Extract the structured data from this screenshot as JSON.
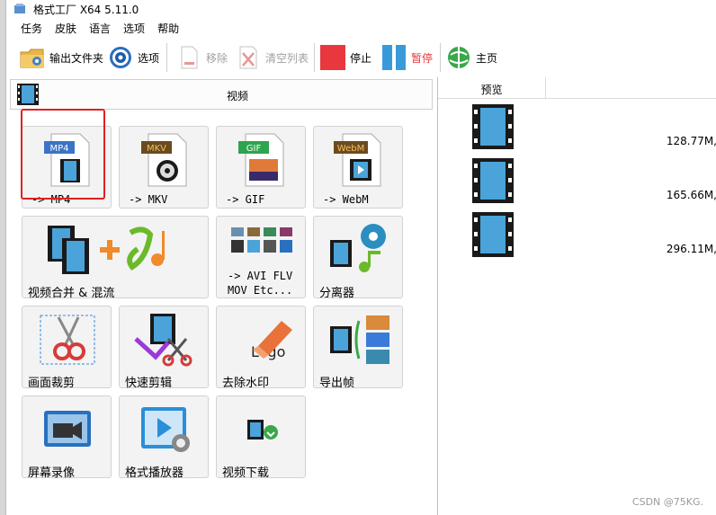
{
  "window": {
    "title": "格式工厂 X64 5.11.0"
  },
  "menu": [
    "任务",
    "皮肤",
    "语言",
    "选项",
    "帮助"
  ],
  "toolbar": {
    "output_folder": "输出文件夹",
    "options": "选项",
    "remove": "移除",
    "clear_list": "清空列表",
    "stop": "停止",
    "pause": "暂停",
    "home": "主页"
  },
  "category": {
    "label": "视频"
  },
  "tiles": {
    "mp4": "-> MP4",
    "mkv": "-> MKV",
    "gif": "-> GIF",
    "webm": "-> WebM",
    "merge": "视频合并 & 混流",
    "avi": "-> AVI FLV\nMOV Etc...",
    "splitter": "分离器",
    "crop": "画面裁剪",
    "quick_cut": "快速剪辑",
    "remove_watermark": "去除水印",
    "export_frames": "导出帧",
    "screen_record": "屏幕录像",
    "player": "格式播放器",
    "download": "视频下载"
  },
  "badges": {
    "mp4": "MP4",
    "mkv": "MKV",
    "gif": "GIF",
    "webm": "WebM",
    "logo": "Logo"
  },
  "preview": {
    "header": "预览",
    "rows": [
      {
        "size": "128.77M,"
      },
      {
        "size": "165.66M,"
      },
      {
        "size": "296.11M,"
      }
    ]
  },
  "watermark": "CSDN @75KG.",
  "colors": {
    "stop": "#e8383d",
    "pause": "#3a9ad9",
    "highlight": "#e02020"
  }
}
